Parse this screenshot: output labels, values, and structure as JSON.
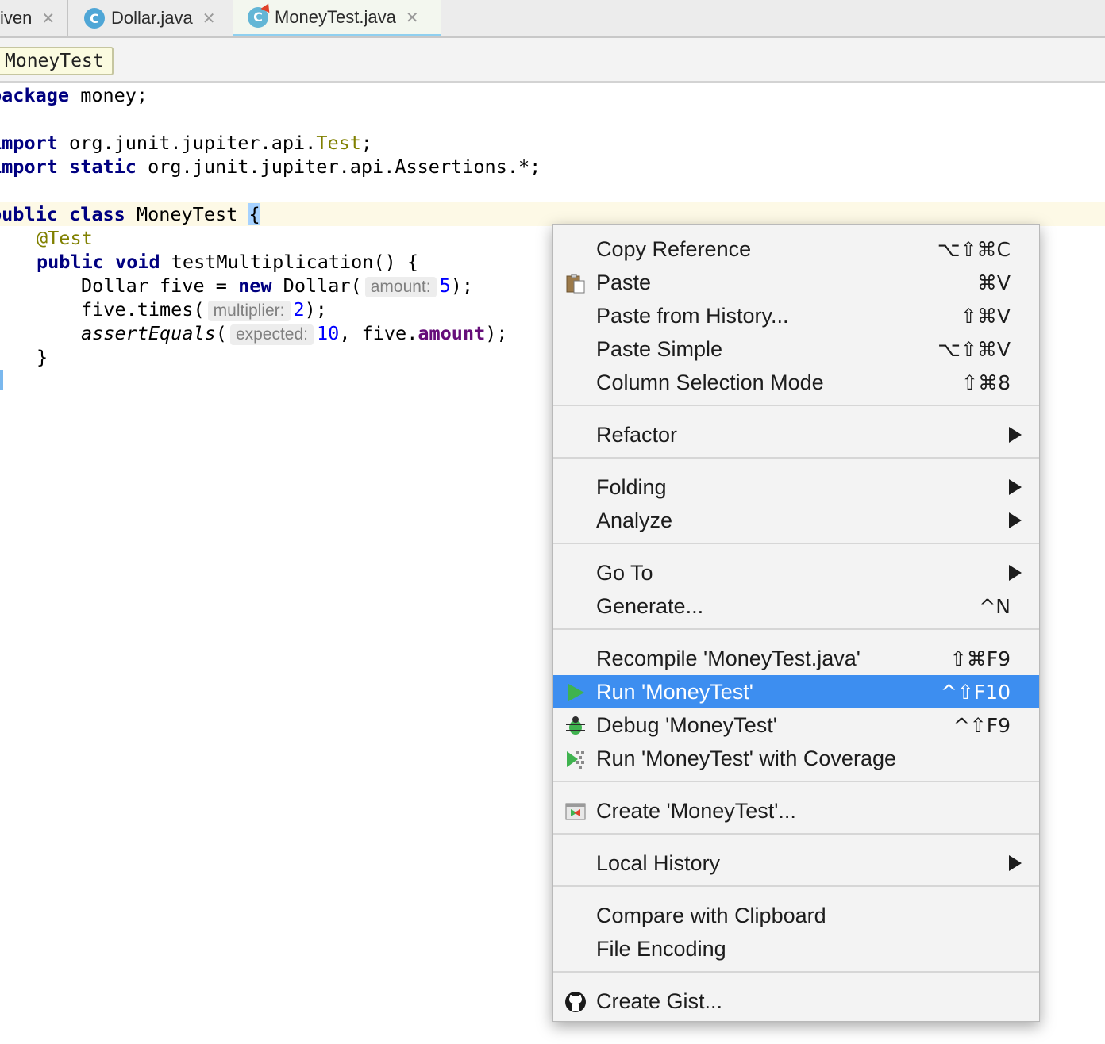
{
  "tabs": [
    {
      "label": "iven",
      "icon": null,
      "active": false
    },
    {
      "label": "Dollar.java",
      "icon": "C",
      "active": false
    },
    {
      "label": "MoneyTest.java",
      "icon": "C",
      "active": true
    }
  ],
  "breadcrumb": "MoneyTest",
  "code": {
    "l1_kw": "package",
    "l1_rest": " money;",
    "l3_kw": "import",
    "l3_pkg": " org.junit.jupiter.api.",
    "l3_cls": "Test",
    "l3_end": ";",
    "l4_kw1": "import",
    "l4_kw2": "static",
    "l4_rest": " org.junit.jupiter.api.Assertions.*;",
    "l6_kw1": "public",
    "l6_kw2": "class",
    "l6_name": " MoneyTest ",
    "l6_brace": "{",
    "l7_ann": "@Test",
    "l8_kw1": "public",
    "l8_kw2": "void",
    "l8_rest": " testMultiplication() {",
    "l9_a": "Dollar five = ",
    "l9_kw": "new",
    "l9_b": " Dollar(",
    "l9_hint": "amount:",
    "l9_num": "5",
    "l9_end": ");",
    "l10_a": "five.times(",
    "l10_hint": "multiplier:",
    "l10_num": "2",
    "l10_end": ");",
    "l11_fn": "assertEquals",
    "l11_a": "(",
    "l11_hint": "expected:",
    "l11_num": "10",
    "l11_b": ", five.",
    "l11_fld": "amount",
    "l11_end": ");",
    "l12": "}"
  },
  "menu": [
    {
      "label": "Copy Reference",
      "shortcut": "⌥⇧⌘C"
    },
    {
      "label": "Paste",
      "shortcut": "⌘V",
      "icon": "clipboard-icon"
    },
    {
      "label": "Paste from History...",
      "shortcut": "⇧⌘V"
    },
    {
      "label": "Paste Simple",
      "shortcut": "⌥⇧⌘V"
    },
    {
      "label": "Column Selection Mode",
      "shortcut": "⇧⌘8"
    },
    {
      "label": "Refactor",
      "submenu": true
    },
    {
      "label": "Folding",
      "submenu": true
    },
    {
      "label": "Analyze",
      "submenu": true
    },
    {
      "label": "Go To",
      "submenu": true
    },
    {
      "label": "Generate...",
      "shortcut": "^N"
    },
    {
      "label": "Recompile 'MoneyTest.java'",
      "shortcut": "⇧⌘F9"
    },
    {
      "label": "Run 'MoneyTest'",
      "shortcut": "^⇧F10",
      "icon": "run-icon",
      "selected": true
    },
    {
      "label": "Debug 'MoneyTest'",
      "shortcut": "^⇧F9",
      "icon": "debug-icon"
    },
    {
      "label": "Run 'MoneyTest' with Coverage",
      "icon": "coverage-icon"
    },
    {
      "label": "Create 'MoneyTest'...",
      "icon": "run-config-icon"
    },
    {
      "label": "Local History",
      "submenu": true
    },
    {
      "label": "Compare with Clipboard"
    },
    {
      "label": "File Encoding"
    },
    {
      "label": "Create Gist...",
      "icon": "github-icon"
    }
  ],
  "colors": {
    "selection": "#3d8ef0",
    "keyword": "#000080",
    "number": "#0000ff",
    "annotation": "#808000"
  }
}
